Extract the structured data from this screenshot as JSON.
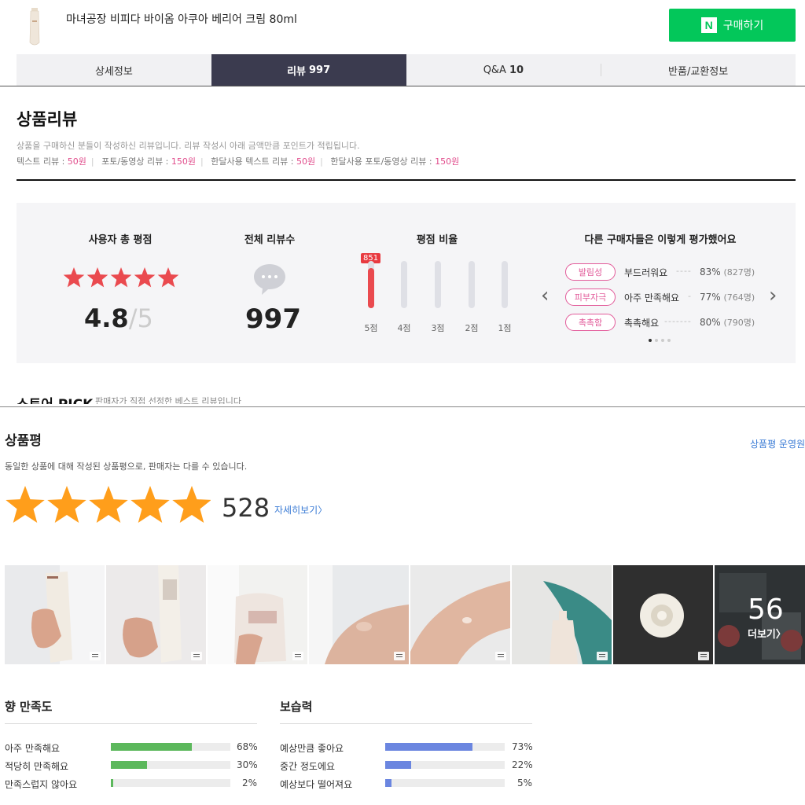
{
  "product": {
    "title": "마녀공장 비피다 바이옴 아쿠아 베리어 크림 80ml"
  },
  "buy_button": {
    "logo": "N",
    "label": "구매하기",
    "color": "#03c75a"
  },
  "tabs": [
    {
      "label": "상세정보",
      "count": ""
    },
    {
      "label": "리뷰",
      "count": "997"
    },
    {
      "label": "Q&A",
      "count": "10"
    },
    {
      "label": "반품/교환정보",
      "count": ""
    }
  ],
  "review": {
    "heading": "상품리뷰",
    "desc": "상품을 구매하신 분들이 작성하신 리뷰입니다. 리뷰 작성시 아래 금액만큼 포인트가 적립됩니다.",
    "points": [
      {
        "label": "텍스트 리뷰 : ",
        "value": "50원"
      },
      {
        "label": "포토/동영상 리뷰 : ",
        "value": "150원"
      },
      {
        "label": "한달사용 텍스트 리뷰 : ",
        "value": "50원"
      },
      {
        "label": "한달사용 포토/동영상 리뷰 : ",
        "value": "150원"
      }
    ]
  },
  "summary": {
    "rating_title": "사용자 총 평점",
    "rating": "4.8",
    "rating_max": "/5",
    "rating_value": 4.8,
    "count_title": "전체 리뷰수",
    "count": "997",
    "ratio_title": "평점 비율",
    "ratio_peak": "851",
    "ratio": [
      {
        "label": "5점",
        "count": 851
      },
      {
        "label": "4점",
        "count": 0
      },
      {
        "label": "3점",
        "count": 0
      },
      {
        "label": "2점",
        "count": 0
      },
      {
        "label": "1점",
        "count": 0
      }
    ],
    "keywords_title": "다른 구매자들은 이렇게 평가했어요",
    "keywords": [
      {
        "tag": "발림성",
        "text": "부드러워요",
        "pct": "83%",
        "people": "(827명)"
      },
      {
        "tag": "피부자극",
        "text": "아주 만족해요",
        "pct": "77%",
        "people": "(764명)"
      },
      {
        "tag": "촉촉함",
        "text": "촉촉해요",
        "pct": "80%",
        "people": "(790명)"
      }
    ],
    "accent": "#ea4a4f",
    "tag_color": "#e25b9a"
  },
  "store_pick": {
    "title": "스토어 PICK",
    "desc": "판매자가 직접 선정한 베스트 리뷰입니다"
  },
  "sangpum": {
    "heading": "상품평",
    "op_link": "상품평 운영원칙",
    "desc": "동일한 상품에 대해 작성된 상품평으로, 판매자는 다를 수 있습니다.",
    "count": "528",
    "more": "자세히보기",
    "star_color": "#ff9e1b"
  },
  "photos": {
    "more_count": "56",
    "more_label": "더보기"
  },
  "attributes": [
    {
      "title": "향 만족도",
      "color": "#5cb85c",
      "rows": [
        {
          "label": "아주 만족해요",
          "pct": "68%",
          "value": 68
        },
        {
          "label": "적당히 만족해요",
          "pct": "30%",
          "value": 30
        },
        {
          "label": "만족스럽지 않아요",
          "pct": "2%",
          "value": 2
        }
      ]
    },
    {
      "title": "보습력",
      "color": "#6b86e0",
      "rows": [
        {
          "label": "예상만큼 좋아요",
          "pct": "73%",
          "value": 73
        },
        {
          "label": "중간 정도에요",
          "pct": "22%",
          "value": 22
        },
        {
          "label": "예상보다 떨어져요",
          "pct": "5%",
          "value": 5
        }
      ]
    }
  ]
}
